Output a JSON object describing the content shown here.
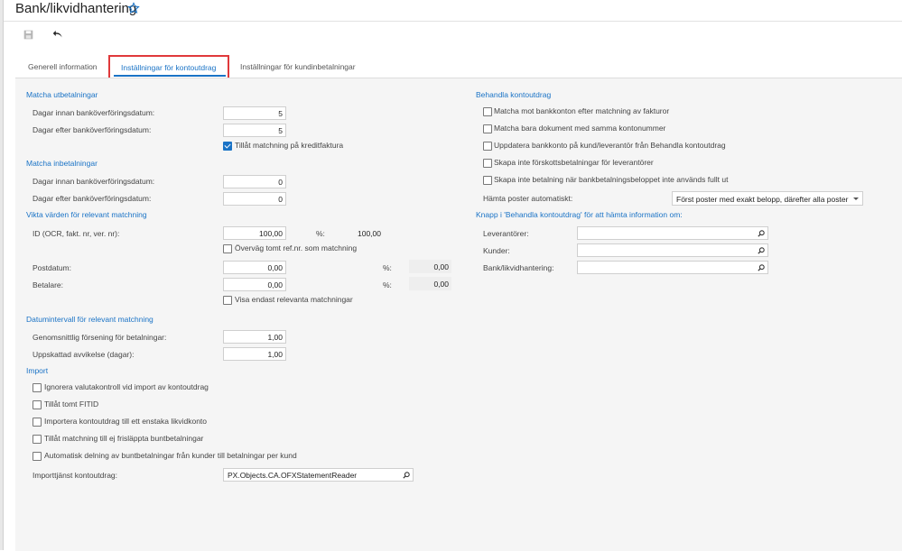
{
  "header": {
    "title": "Bank/likvidhantering"
  },
  "tabs": {
    "general": "Generell information",
    "statement": "Inställningar för kontoutdrag",
    "customer": "Inställningar för kundinbetalningar"
  },
  "payments_out": {
    "title": "Matcha utbetalningar",
    "days_before_label": "Dagar innan banköverföringsdatum:",
    "days_before": "5",
    "days_after_label": "Dagar efter banköverföringsdatum:",
    "days_after": "5",
    "allow_credit_label": "Tillåt matchning på kreditfaktura"
  },
  "payments_in": {
    "title": "Matcha inbetalningar",
    "days_before_label": "Dagar innan banköverföringsdatum:",
    "days_before": "0",
    "days_after_label": "Dagar efter banköverföringsdatum:",
    "days_after": "0"
  },
  "weights": {
    "title": "Vikta värden för relevant matchning",
    "id_label": "ID (OCR, fakt. nr, ver. nr):",
    "id_value": "100,00",
    "pct_label": "%:",
    "id_pct": "100,00",
    "empty_ref_label": "Överväg tomt ref.nr. som matchning",
    "postdate_label": "Postdatum:",
    "postdate_value": "0,00",
    "postdate_pct": "0,00",
    "payer_label": "Betalare:",
    "payer_value": "0,00",
    "payer_pct": "0,00",
    "relevant_only_label": "Visa endast relevanta matchningar"
  },
  "date_interval": {
    "title": "Datumintervall för relevant matchning",
    "avg_delay_label": "Genomsnittlig försening för betalningar:",
    "avg_delay": "1,00",
    "est_dev_label": "Uppskattad avvikelse (dagar):",
    "est_dev": "1,00"
  },
  "import": {
    "title": "Import",
    "options": [
      "Ignorera valutakontroll vid import av kontoutdrag",
      "Tillåt tomt FITID",
      "Importera kontoutdrag till ett enstaka likvidkonto",
      "Tillåt matchning till ej frisläppta buntbetalningar",
      "Automatisk delning av buntbetalningar från kunder till betalningar per kund"
    ],
    "service_label": "Importtjänst kontoutdrag:",
    "service_value": "PX.Objects.CA.OFXStatementReader"
  },
  "process": {
    "title": "Behandla kontoutdrag",
    "options": [
      "Matcha mot bankkonton efter matchning av fakturor",
      "Matcha bara dokument med samma kontonummer",
      "Uppdatera bankkonto på kund/leverantör från Behandla kontoutdrag",
      "Skapa inte förskottsbetalningar för leverantörer",
      "Skapa inte betalning när bankbetalningsbeloppet inte används fullt ut"
    ],
    "auto_fetch_label": "Hämta poster automatiskt:",
    "auto_fetch_value": "Först poster med exakt belopp, därefter alla poster"
  },
  "button_info": {
    "title": "Knapp i 'Behandla kontoutdrag' för att hämta information om:",
    "vendors_label": "Leverantörer:",
    "customers_label": "Kunder:",
    "bank_label": "Bank/likvidhantering:"
  },
  "colors": {
    "accent": "#1a73c6",
    "highlight": "#e0393b"
  }
}
